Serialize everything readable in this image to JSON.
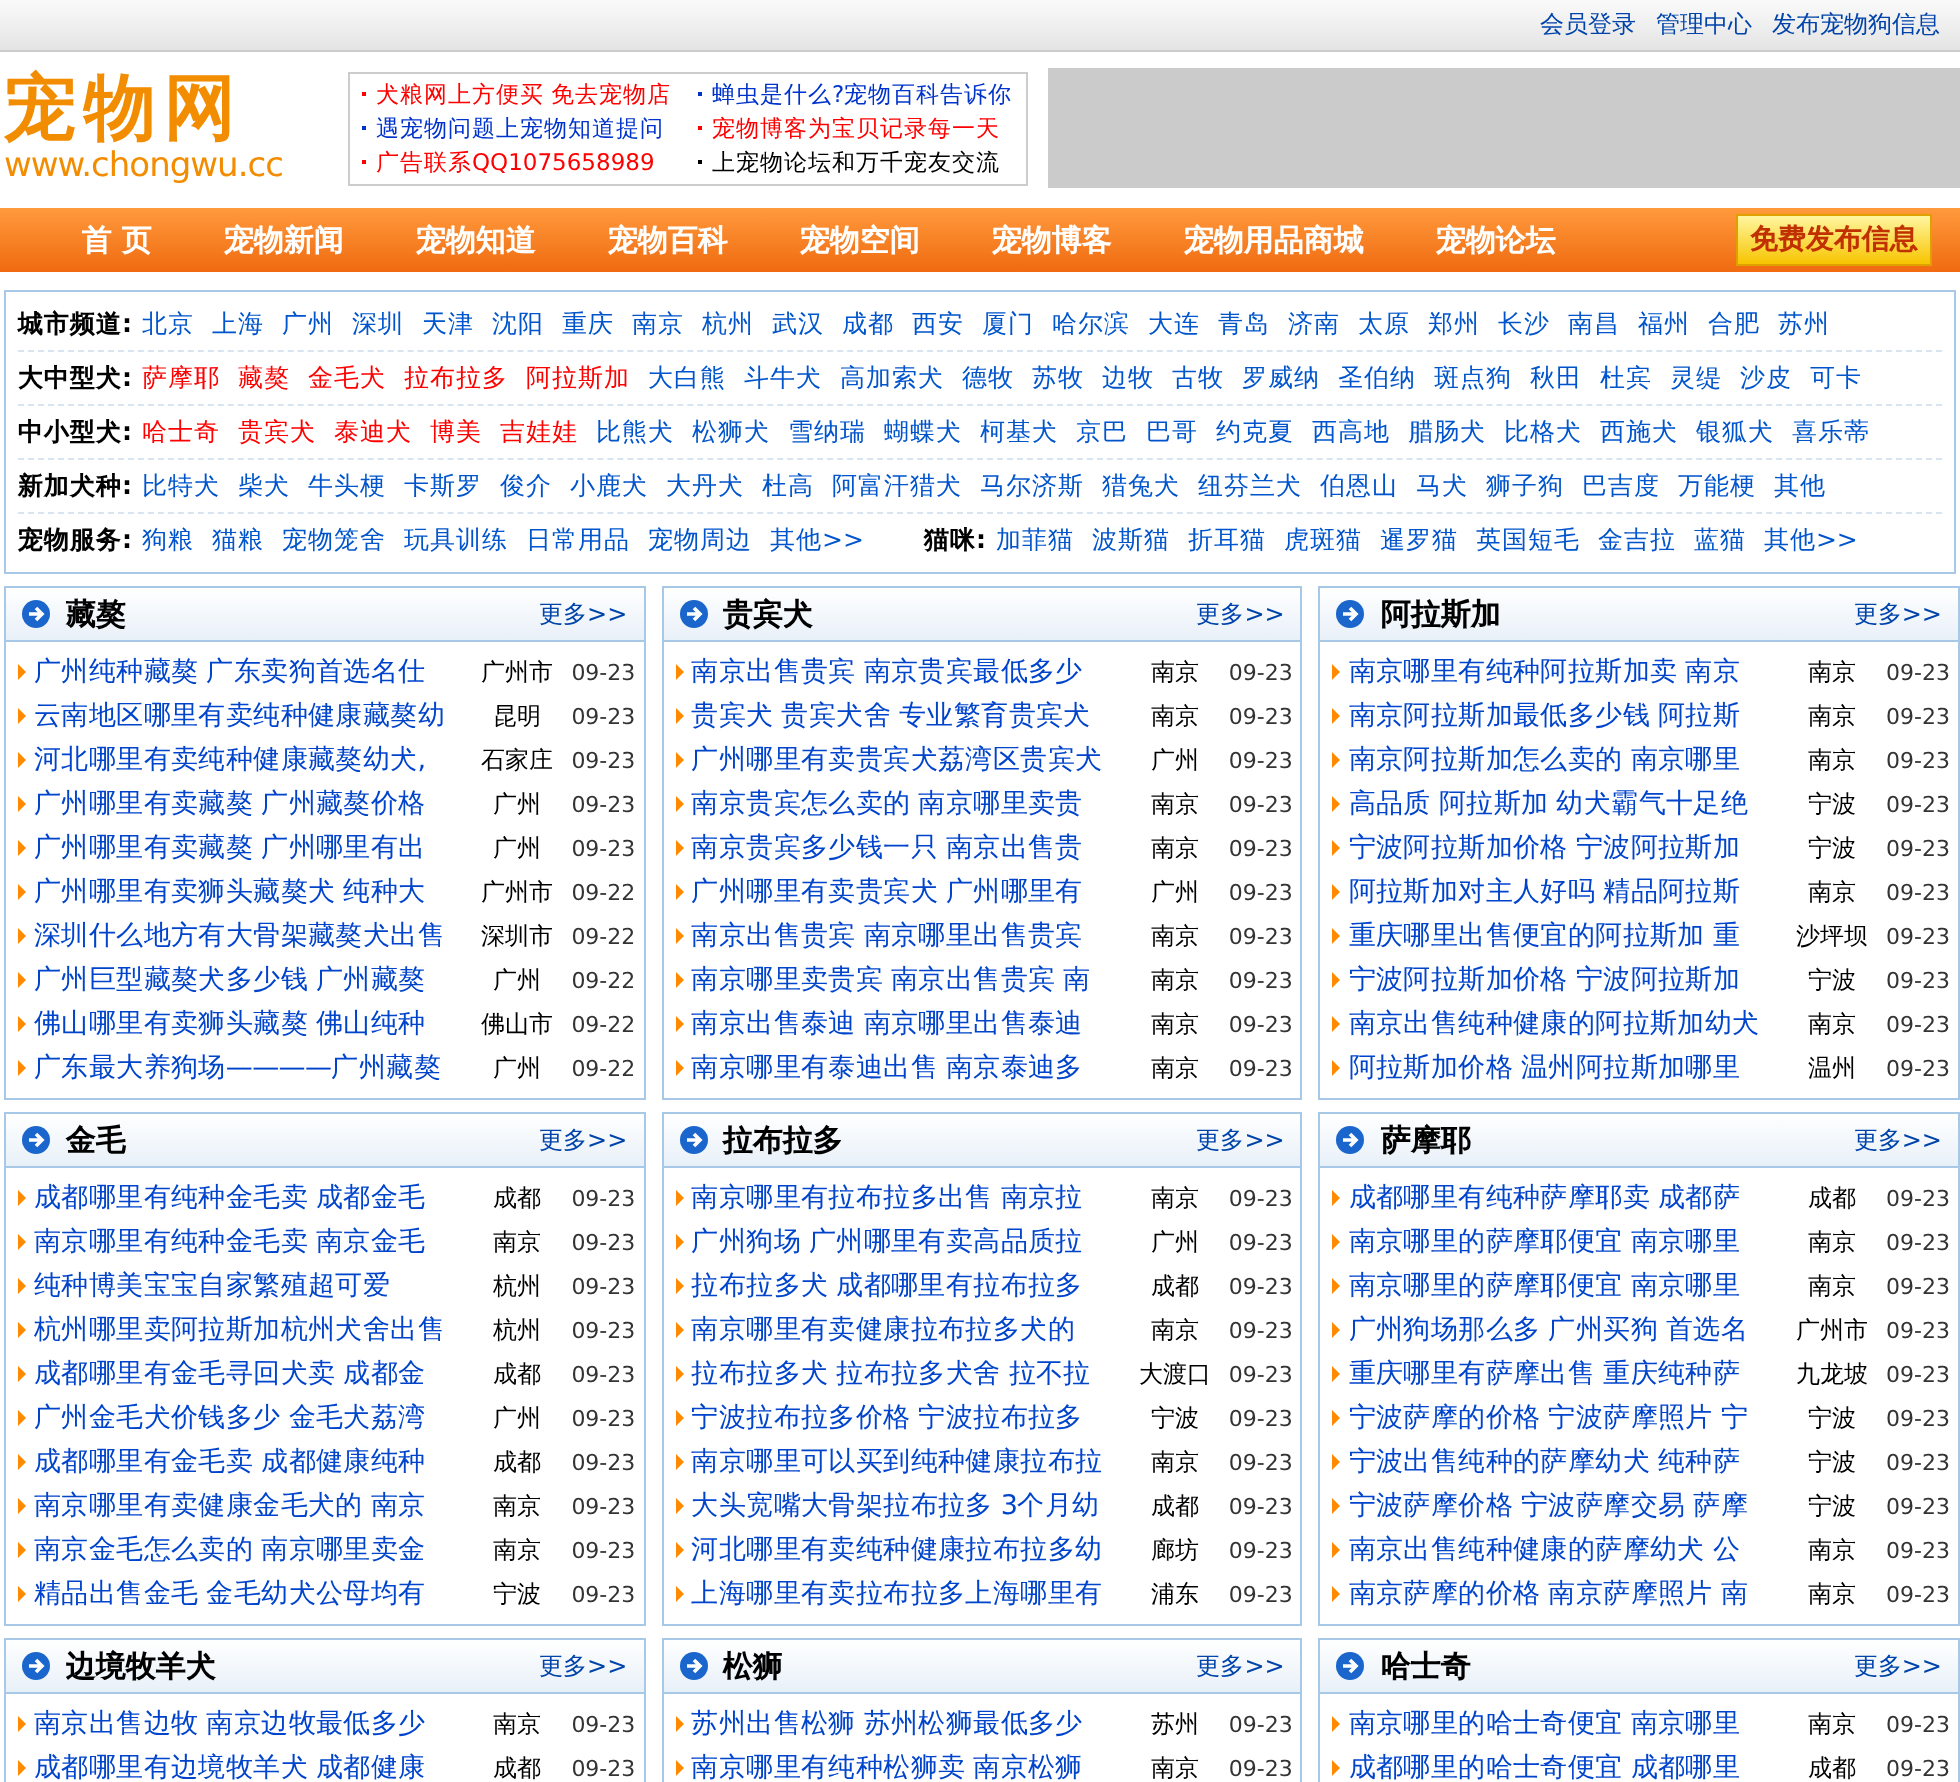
{
  "top_links": [
    "会员登录",
    "管理中心",
    "发布宠物狗信息"
  ],
  "logo": {
    "name": "宠物网",
    "url": "www.chongwu.cc"
  },
  "ads": [
    {
      "text": "犬粮网上方便买 免去宠物店",
      "color": "#ff0000"
    },
    {
      "text": "蝉虫是什么?宠物百科告诉你",
      "color": "#0033cc"
    },
    {
      "text": "遇宠物问题上宠物知道提问",
      "color": "#0033cc"
    },
    {
      "text": "宠物博客为宝贝记录每一天",
      "color": "#ff0000"
    },
    {
      "text": "广告联系QQ1075658989",
      "color": "#ff0000"
    },
    {
      "text": "上宠物论坛和万千宠友交流",
      "color": "#000000"
    }
  ],
  "nav": {
    "items": [
      "首 页",
      "宠物新闻",
      "宠物知道",
      "宠物百科",
      "宠物空间",
      "宠物博客",
      "宠物用品商城",
      "宠物论坛"
    ],
    "button": "免费发布信息"
  },
  "channels": [
    {
      "groups": [
        {
          "label": "城市频道:",
          "links": [
            {
              "text": "北京",
              "color": "#0055cc"
            },
            {
              "text": "上海",
              "color": "#0055cc"
            },
            {
              "text": "广州",
              "color": "#0055cc"
            },
            {
              "text": "深圳",
              "color": "#0055cc"
            },
            {
              "text": "天津",
              "color": "#0055cc"
            },
            {
              "text": "沈阳",
              "color": "#0055cc"
            },
            {
              "text": "重庆",
              "color": "#0055cc"
            },
            {
              "text": "南京",
              "color": "#0055cc"
            },
            {
              "text": "杭州",
              "color": "#0055cc"
            },
            {
              "text": "武汉",
              "color": "#0055cc"
            },
            {
              "text": "成都",
              "color": "#0055cc"
            },
            {
              "text": "西安",
              "color": "#0055cc"
            },
            {
              "text": "厦门",
              "color": "#0055cc"
            },
            {
              "text": "哈尔滨",
              "color": "#0055cc"
            },
            {
              "text": "大连",
              "color": "#0055cc"
            },
            {
              "text": "青岛",
              "color": "#0055cc"
            },
            {
              "text": "济南",
              "color": "#0055cc"
            },
            {
              "text": "太原",
              "color": "#0055cc"
            },
            {
              "text": "郑州",
              "color": "#0055cc"
            },
            {
              "text": "长沙",
              "color": "#0055cc"
            },
            {
              "text": "南昌",
              "color": "#0055cc"
            },
            {
              "text": "福州",
              "color": "#0055cc"
            },
            {
              "text": "合肥",
              "color": "#0055cc"
            },
            {
              "text": "苏州",
              "color": "#0055cc"
            }
          ]
        }
      ]
    },
    {
      "groups": [
        {
          "label": "大中型犬:",
          "links": [
            {
              "text": "萨摩耶",
              "color": "#ff0000"
            },
            {
              "text": "藏獒",
              "color": "#ff0000"
            },
            {
              "text": "金毛犬",
              "color": "#ff0000"
            },
            {
              "text": "拉布拉多",
              "color": "#ff0000"
            },
            {
              "text": "阿拉斯加",
              "color": "#ff0000"
            },
            {
              "text": "大白熊",
              "color": "#0055cc"
            },
            {
              "text": "斗牛犬",
              "color": "#0055cc"
            },
            {
              "text": "高加索犬",
              "color": "#0055cc"
            },
            {
              "text": "德牧",
              "color": "#0055cc"
            },
            {
              "text": "苏牧",
              "color": "#0055cc"
            },
            {
              "text": "边牧",
              "color": "#0055cc"
            },
            {
              "text": "古牧",
              "color": "#0055cc"
            },
            {
              "text": "罗威纳",
              "color": "#0055cc"
            },
            {
              "text": "圣伯纳",
              "color": "#0055cc"
            },
            {
              "text": "斑点狗",
              "color": "#0055cc"
            },
            {
              "text": "秋田",
              "color": "#0055cc"
            },
            {
              "text": "杜宾",
              "color": "#0055cc"
            },
            {
              "text": "灵缇",
              "color": "#0055cc"
            },
            {
              "text": "沙皮",
              "color": "#0055cc"
            },
            {
              "text": "可卡",
              "color": "#0055cc"
            }
          ]
        }
      ]
    },
    {
      "groups": [
        {
          "label": "中小型犬:",
          "links": [
            {
              "text": "哈士奇",
              "color": "#ff0000"
            },
            {
              "text": "贵宾犬",
              "color": "#ff0000"
            },
            {
              "text": "泰迪犬",
              "color": "#ff0000"
            },
            {
              "text": "博美",
              "color": "#ff0000"
            },
            {
              "text": "吉娃娃",
              "color": "#ff0000"
            },
            {
              "text": "比熊犬",
              "color": "#0055cc"
            },
            {
              "text": "松狮犬",
              "color": "#0055cc"
            },
            {
              "text": "雪纳瑞",
              "color": "#0055cc"
            },
            {
              "text": "蝴蝶犬",
              "color": "#0055cc"
            },
            {
              "text": "柯基犬",
              "color": "#0055cc"
            },
            {
              "text": "京巴",
              "color": "#0055cc"
            },
            {
              "text": "巴哥",
              "color": "#0055cc"
            },
            {
              "text": "约克夏",
              "color": "#0055cc"
            },
            {
              "text": "西高地",
              "color": "#0055cc"
            },
            {
              "text": "腊肠犬",
              "color": "#0055cc"
            },
            {
              "text": "比格犬",
              "color": "#0055cc"
            },
            {
              "text": "西施犬",
              "color": "#0055cc"
            },
            {
              "text": "银狐犬",
              "color": "#0055cc"
            },
            {
              "text": "喜乐蒂",
              "color": "#0055cc"
            }
          ]
        }
      ]
    },
    {
      "groups": [
        {
          "label": "新加犬种:",
          "links": [
            {
              "text": "比特犬",
              "color": "#0055cc"
            },
            {
              "text": "柴犬",
              "color": "#0055cc"
            },
            {
              "text": "牛头梗",
              "color": "#0055cc"
            },
            {
              "text": "卡斯罗",
              "color": "#0055cc"
            },
            {
              "text": "俊介",
              "color": "#0055cc"
            },
            {
              "text": "小鹿犬",
              "color": "#0055cc"
            },
            {
              "text": "大丹犬",
              "color": "#0055cc"
            },
            {
              "text": "杜高",
              "color": "#0055cc"
            },
            {
              "text": "阿富汗猎犬",
              "color": "#0055cc"
            },
            {
              "text": "马尔济斯",
              "color": "#0055cc"
            },
            {
              "text": "猎兔犬",
              "color": "#0055cc"
            },
            {
              "text": "纽芬兰犬",
              "color": "#0055cc"
            },
            {
              "text": "伯恩山",
              "color": "#0055cc"
            },
            {
              "text": "马犬",
              "color": "#0055cc"
            },
            {
              "text": "狮子狗",
              "color": "#0055cc"
            },
            {
              "text": "巴吉度",
              "color": "#0055cc"
            },
            {
              "text": "万能梗",
              "color": "#0055cc"
            },
            {
              "text": "其他",
              "color": "#0055cc"
            }
          ]
        }
      ]
    },
    {
      "groups": [
        {
          "label": "宠物服务:",
          "links": [
            {
              "text": "狗粮",
              "color": "#0055cc"
            },
            {
              "text": "猫粮",
              "color": "#0055cc"
            },
            {
              "text": "宠物笼舍",
              "color": "#0055cc"
            },
            {
              "text": "玩具训练",
              "color": "#0055cc"
            },
            {
              "text": "日常用品",
              "color": "#0055cc"
            },
            {
              "text": "宠物周边",
              "color": "#0055cc"
            },
            {
              "text": "其他>>",
              "color": "#0055cc"
            }
          ]
        },
        {
          "label": "猫咪:",
          "links": [
            {
              "text": "加菲猫",
              "color": "#0055cc"
            },
            {
              "text": "波斯猫",
              "color": "#0055cc"
            },
            {
              "text": "折耳猫",
              "color": "#0055cc"
            },
            {
              "text": "虎斑猫",
              "color": "#0055cc"
            },
            {
              "text": "暹罗猫",
              "color": "#0055cc"
            },
            {
              "text": "英国短毛",
              "color": "#0055cc"
            },
            {
              "text": "金吉拉",
              "color": "#0055cc"
            },
            {
              "text": "蓝猫",
              "color": "#0055cc"
            },
            {
              "text": "其他>>",
              "color": "#0055cc"
            }
          ]
        }
      ]
    }
  ],
  "panels": [
    {
      "title": "藏獒",
      "more": "更多>>",
      "rows": [
        {
          "title": "广州纯种藏獒 广东卖狗首选名仕",
          "city": "广州市",
          "date": "09-23"
        },
        {
          "title": "云南地区哪里有卖纯种健康藏獒幼",
          "city": "昆明",
          "date": "09-23"
        },
        {
          "title": "河北哪里有卖纯种健康藏獒幼犬,",
          "city": "石家庄",
          "date": "09-23"
        },
        {
          "title": "广州哪里有卖藏獒 广州藏獒价格",
          "city": "广州",
          "date": "09-23"
        },
        {
          "title": "广州哪里有卖藏獒 广州哪里有出",
          "city": "广州",
          "date": "09-23"
        },
        {
          "title": "广州哪里有卖狮头藏獒犬 纯种大",
          "city": "广州市",
          "date": "09-22"
        },
        {
          "title": "深圳什么地方有大骨架藏獒犬出售",
          "city": "深圳市",
          "date": "09-22"
        },
        {
          "title": "广州巨型藏獒犬多少钱 广州藏獒",
          "city": "广州",
          "date": "09-22"
        },
        {
          "title": "佛山哪里有卖狮头藏獒 佛山纯种",
          "city": "佛山市",
          "date": "09-22"
        },
        {
          "title": "广东最大养狗场————广州藏獒",
          "city": "广州",
          "date": "09-22"
        }
      ]
    },
    {
      "title": "贵宾犬",
      "more": "更多>>",
      "rows": [
        {
          "title": "南京出售贵宾 南京贵宾最低多少",
          "city": "南京",
          "date": "09-23"
        },
        {
          "title": "贵宾犬 贵宾犬舍 专业繁育贵宾犬",
          "city": "南京",
          "date": "09-23"
        },
        {
          "title": "广州哪里有卖贵宾犬荔湾区贵宾犬",
          "city": "广州",
          "date": "09-23"
        },
        {
          "title": "南京贵宾怎么卖的 南京哪里卖贵",
          "city": "南京",
          "date": "09-23"
        },
        {
          "title": "南京贵宾多少钱一只 南京出售贵",
          "city": "南京",
          "date": "09-23"
        },
        {
          "title": "广州哪里有卖贵宾犬 广州哪里有",
          "city": "广州",
          "date": "09-23"
        },
        {
          "title": "南京出售贵宾 南京哪里出售贵宾",
          "city": "南京",
          "date": "09-23"
        },
        {
          "title": "南京哪里卖贵宾 南京出售贵宾 南",
          "city": "南京",
          "date": "09-23"
        },
        {
          "title": "南京出售泰迪 南京哪里出售泰迪",
          "city": "南京",
          "date": "09-23"
        },
        {
          "title": "南京哪里有泰迪出售 南京泰迪多",
          "city": "南京",
          "date": "09-23"
        }
      ]
    },
    {
      "title": "阿拉斯加",
      "more": "更多>>",
      "rows": [
        {
          "title": "南京哪里有纯种阿拉斯加卖 南京",
          "city": "南京",
          "date": "09-23"
        },
        {
          "title": "南京阿拉斯加最低多少钱 阿拉斯",
          "city": "南京",
          "date": "09-23"
        },
        {
          "title": "南京阿拉斯加怎么卖的 南京哪里",
          "city": "南京",
          "date": "09-23"
        },
        {
          "title": "高品质 阿拉斯加 幼犬霸气十足绝",
          "city": "宁波",
          "date": "09-23"
        },
        {
          "title": "宁波阿拉斯加价格 宁波阿拉斯加",
          "city": "宁波",
          "date": "09-23"
        },
        {
          "title": "阿拉斯加对主人好吗 精品阿拉斯",
          "city": "南京",
          "date": "09-23"
        },
        {
          "title": "重庆哪里出售便宜的阿拉斯加 重",
          "city": "沙坪坝",
          "date": "09-23"
        },
        {
          "title": "宁波阿拉斯加价格 宁波阿拉斯加",
          "city": "宁波",
          "date": "09-23"
        },
        {
          "title": "南京出售纯种健康的阿拉斯加幼犬",
          "city": "南京",
          "date": "09-23"
        },
        {
          "title": "阿拉斯加价格 温州阿拉斯加哪里",
          "city": "温州",
          "date": "09-23"
        }
      ]
    },
    {
      "title": "金毛",
      "more": "更多>>",
      "rows": [
        {
          "title": "成都哪里有纯种金毛卖 成都金毛",
          "city": "成都",
          "date": "09-23"
        },
        {
          "title": "南京哪里有纯种金毛卖 南京金毛",
          "city": "南京",
          "date": "09-23"
        },
        {
          "title": "纯种博美宝宝自家繁殖超可爱",
          "city": "杭州",
          "date": "09-23"
        },
        {
          "title": "杭州哪里卖阿拉斯加杭州犬舍出售",
          "city": "杭州",
          "date": "09-23"
        },
        {
          "title": "成都哪里有金毛寻回犬卖 成都金",
          "city": "成都",
          "date": "09-23"
        },
        {
          "title": "广州金毛犬价钱多少 金毛犬荔湾",
          "city": "广州",
          "date": "09-23"
        },
        {
          "title": "成都哪里有金毛卖 成都健康纯种",
          "city": "成都",
          "date": "09-23"
        },
        {
          "title": "南京哪里有卖健康金毛犬的 南京",
          "city": "南京",
          "date": "09-23"
        },
        {
          "title": "南京金毛怎么卖的 南京哪里卖金",
          "city": "南京",
          "date": "09-23"
        },
        {
          "title": "精品出售金毛 金毛幼犬公母均有",
          "city": "宁波",
          "date": "09-23"
        }
      ]
    },
    {
      "title": "拉布拉多",
      "more": "更多>>",
      "rows": [
        {
          "title": "南京哪里有拉布拉多出售 南京拉",
          "city": "南京",
          "date": "09-23"
        },
        {
          "title": "广州狗场 广州哪里有卖高品质拉",
          "city": "广州",
          "date": "09-23"
        },
        {
          "title": "拉布拉多犬 成都哪里有拉布拉多",
          "city": "成都",
          "date": "09-23"
        },
        {
          "title": "南京哪里有卖健康拉布拉多犬的",
          "city": "南京",
          "date": "09-23"
        },
        {
          "title": "拉布拉多犬 拉布拉多犬舍 拉不拉",
          "city": "大渡口",
          "date": "09-23"
        },
        {
          "title": "宁波拉布拉多价格 宁波拉布拉多",
          "city": "宁波",
          "date": "09-23"
        },
        {
          "title": "南京哪里可以买到纯种健康拉布拉",
          "city": "南京",
          "date": "09-23"
        },
        {
          "title": "大头宽嘴大骨架拉布拉多 3个月幼",
          "city": "成都",
          "date": "09-23"
        },
        {
          "title": "河北哪里有卖纯种健康拉布拉多幼",
          "city": "廊坊",
          "date": "09-23"
        },
        {
          "title": "上海哪里有卖拉布拉多上海哪里有",
          "city": "浦东",
          "date": "09-23"
        }
      ]
    },
    {
      "title": "萨摩耶",
      "more": "更多>>",
      "rows": [
        {
          "title": "成都哪里有纯种萨摩耶卖 成都萨",
          "city": "成都",
          "date": "09-23"
        },
        {
          "title": "南京哪里的萨摩耶便宜 南京哪里",
          "city": "南京",
          "date": "09-23"
        },
        {
          "title": "南京哪里的萨摩耶便宜 南京哪里",
          "city": "南京",
          "date": "09-23"
        },
        {
          "title": "广州狗场那么多 广州买狗 首选名",
          "city": "广州市",
          "date": "09-23"
        },
        {
          "title": "重庆哪里有萨摩出售 重庆纯种萨",
          "city": "九龙坡",
          "date": "09-23"
        },
        {
          "title": "宁波萨摩的价格 宁波萨摩照片 宁",
          "city": "宁波",
          "date": "09-23"
        },
        {
          "title": "宁波出售纯种的萨摩幼犬 纯种萨",
          "city": "宁波",
          "date": "09-23"
        },
        {
          "title": "宁波萨摩价格 宁波萨摩交易 萨摩",
          "city": "宁波",
          "date": "09-23"
        },
        {
          "title": "南京出售纯种健康的萨摩幼犬 公",
          "city": "南京",
          "date": "09-23"
        },
        {
          "title": "南京萨摩的价格 南京萨摩照片 南",
          "city": "南京",
          "date": "09-23"
        }
      ]
    },
    {
      "title": "边境牧羊犬",
      "more": "更多>>",
      "rows": [
        {
          "title": "南京出售边牧 南京边牧最低多少",
          "city": "南京",
          "date": "09-23"
        },
        {
          "title": "成都哪里有边境牧羊犬 成都健康",
          "city": "成都",
          "date": "09-23"
        }
      ]
    },
    {
      "title": "松狮",
      "more": "更多>>",
      "rows": [
        {
          "title": "苏州出售松狮 苏州松狮最低多少",
          "city": "苏州",
          "date": "09-23"
        },
        {
          "title": "南京哪里有纯种松狮卖 南京松狮",
          "city": "南京",
          "date": "09-23"
        }
      ]
    },
    {
      "title": "哈士奇",
      "more": "更多>>",
      "rows": [
        {
          "title": "南京哪里的哈士奇便宜 南京哪里",
          "city": "南京",
          "date": "09-23"
        },
        {
          "title": "成都哪里的哈士奇便宜 成都哪里",
          "city": "成都",
          "date": "09-23"
        }
      ]
    }
  ]
}
